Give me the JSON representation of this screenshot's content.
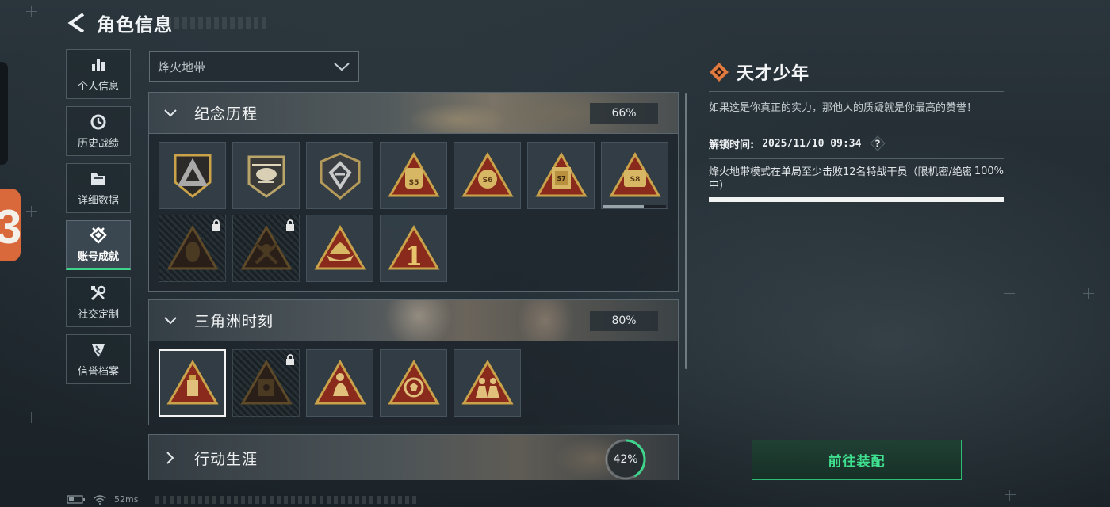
{
  "header": {
    "title": "角色信息",
    "back_icon": "chevron-left-icon"
  },
  "nav": {
    "items": [
      {
        "label": "个人信息",
        "icon": "bar-chart-icon",
        "active": false
      },
      {
        "label": "历史战绩",
        "icon": "history-clock-icon",
        "active": false
      },
      {
        "label": "详细数据",
        "icon": "folder-icon",
        "active": false
      },
      {
        "label": "账号成就",
        "icon": "achievement-icon",
        "active": true
      },
      {
        "label": "社交定制",
        "icon": "wrench-icon",
        "active": false
      },
      {
        "label": "信誉档案",
        "icon": "shield-icon",
        "active": false
      }
    ]
  },
  "mode_select": {
    "value": "烽火地带"
  },
  "sections": [
    {
      "title": "纪念历程",
      "percent": "66%",
      "expanded": true,
      "badges": [
        {
          "icon": "triangle-shield-badge-icon",
          "locked": false,
          "label": ""
        },
        {
          "icon": "helicopter-badge-icon",
          "locked": false,
          "label": ""
        },
        {
          "icon": "emblem-shield-badge-icon",
          "locked": false,
          "label": ""
        },
        {
          "icon": "crate-badge-icon",
          "locked": false,
          "label": "S5"
        },
        {
          "icon": "crate-badge-icon",
          "locked": false,
          "label": "S6"
        },
        {
          "icon": "crate-badge-icon",
          "locked": false,
          "label": "S7"
        },
        {
          "icon": "crate-badge-icon",
          "locked": false,
          "label": "S8",
          "progress": 0.65
        },
        {
          "icon": "mask-badge-icon",
          "locked": true,
          "label": ""
        },
        {
          "icon": "crossed-swords-badge-icon",
          "locked": true,
          "label": ""
        },
        {
          "icon": "ship-badge-icon",
          "locked": false,
          "label": ""
        },
        {
          "icon": "number-one-badge-icon",
          "locked": false,
          "label": "1"
        }
      ]
    },
    {
      "title": "三角洲时刻",
      "percent": "80%",
      "expanded": true,
      "badges": [
        {
          "icon": "usb-badge-icon",
          "locked": false,
          "selected": true,
          "label": ""
        },
        {
          "icon": "safe-badge-icon",
          "locked": true,
          "label": ""
        },
        {
          "icon": "figure-badge-icon",
          "locked": false,
          "label": ""
        },
        {
          "icon": "soccer-badge-icon",
          "locked": false,
          "label": ""
        },
        {
          "icon": "squad-badge-icon",
          "locked": false,
          "label": ""
        }
      ]
    },
    {
      "title": "行动生涯",
      "percent": "42%",
      "progress": 0.42,
      "expanded": false
    }
  ],
  "detail": {
    "title": "天才少年",
    "title_icon": "diamond-emblem-icon",
    "description": "如果这是你真正的实力，那他人的质疑就是你最高的赞誉！",
    "unlock_label": "解锁时间:",
    "unlock_time": "2025/11/10 09:34",
    "help_icon": "question-icon",
    "condition": "烽火地带模式在单局至少击败12名特战干员（限机密/绝密行动中）",
    "condition_percent": "100%",
    "condition_progress": 1.0
  },
  "equip_button": {
    "label": "前往装配"
  },
  "status_bar": {
    "ping": "52ms",
    "battery_icon": "battery-icon",
    "wifi_icon": "wifi-icon"
  },
  "colors": {
    "accent_green": "#3fd48b",
    "badge_red": "#8a2a1c",
    "badge_gold": "#c9a24a",
    "title_orange": "#e07a3f"
  }
}
